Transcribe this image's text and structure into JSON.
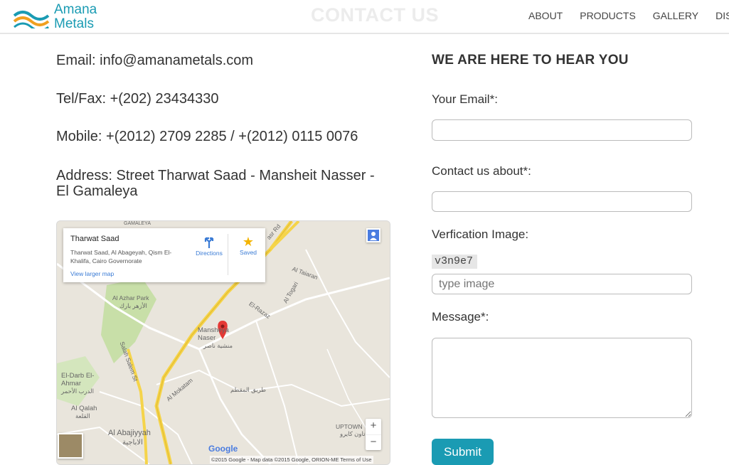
{
  "header": {
    "logo_line1": "Amana",
    "logo_line2": "Metals",
    "page_heading": "CONTACT US",
    "nav": [
      "ABOUT",
      "PRODUCTS",
      "GALLERY",
      "DISTR"
    ]
  },
  "contact": {
    "email": "Email: info@amanametals.com",
    "tel": "Tel/Fax: +(202) 23434330",
    "mobile": "Mobile: +(2012) 2709 2285 / +(2012) 0115 0076",
    "address": "Address: Street Tharwat Saad - Mansheit Nasser - El Gamaleya"
  },
  "map": {
    "card_title": "Tharwat Saad",
    "card_address": "Tharwat Saad, Al Abageyah, Qism El-Khalifa, Cairo Governorate",
    "card_link": "View larger map",
    "directions_label": "Directions",
    "saved_label": "Saved",
    "zoom_in": "+",
    "zoom_out": "−",
    "google_logo": "Google",
    "attribution": "©2015 Google - Map data ©2015 Google, ORION-ME   Terms of Use",
    "labels": {
      "azhar_park": "Al Azhar Park",
      "azhar_park_ar": "الأزهر بارك",
      "salah_salem": "Salah Salem St",
      "mansheya": "Mansheya Naser",
      "mansheya_ar": "منشية ناصر",
      "el_darb": "El-Darb El-Ahmar",
      "el_darb_ar": "الدرب الأحمر",
      "al_qalah": "Al Qalah",
      "al_qalah_ar": "القلعة",
      "al_abajiyyah": "Al Abajiyyah",
      "al_abajiyyah_ar": "الاباجية",
      "al_mokatam": "Al Mokatam",
      "mokattam_ar": "طريق المقطم",
      "el_razaz": "El-Razaz",
      "al_togari": "Al Togari",
      "al_taiaran": "Al Taiaran",
      "uptown": "UPTOWN",
      "uptown_ar": "أب تاون كايرو",
      "asr_rd": "asr Rd",
      "gamaleya": "GAMALEYA"
    }
  },
  "form": {
    "title": "WE ARE HERE TO HEAR YOU",
    "email_label": "Your Email*:",
    "email_value": "",
    "about_label": "Contact us about*:",
    "about_value": "",
    "verify_label": "Verfication Image:",
    "captcha": "v3n9e7",
    "captcha_placeholder": "type image",
    "message_label": "Message*:",
    "message_value": "",
    "submit_label": "Submit"
  },
  "colors": {
    "brand": "#1a9bb3",
    "text": "#333333",
    "map_road": "#f5d44a",
    "map_pin": "#e53935"
  }
}
